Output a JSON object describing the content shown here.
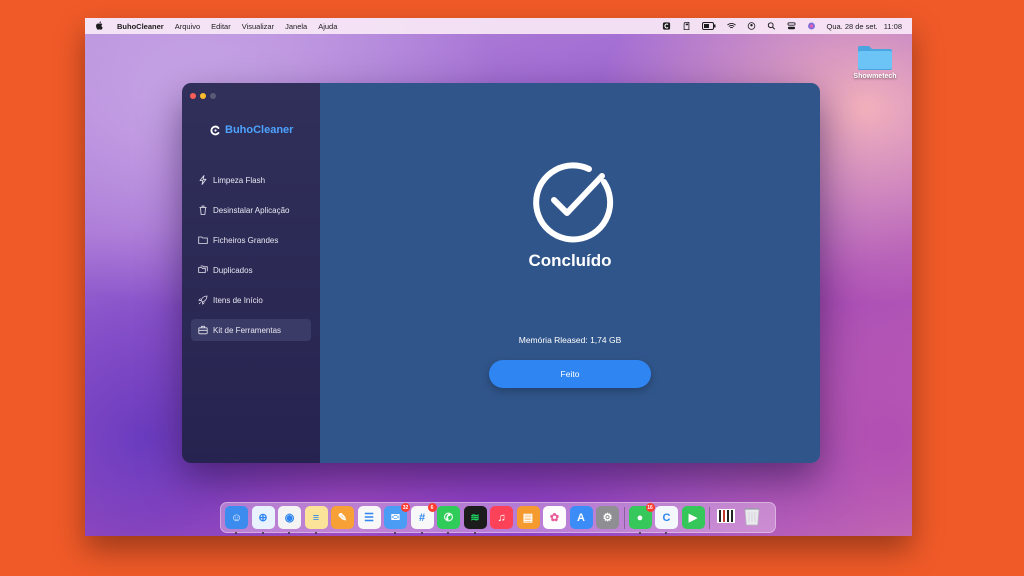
{
  "menubar": {
    "app_name": "BuhoCleaner",
    "menus": [
      "Arquivo",
      "Editar",
      "Visualizar",
      "Janela",
      "Ajuda"
    ],
    "date": "Qua. 28 de set.",
    "time": "11:08",
    "status_icons": [
      "buhocleaner-icon",
      "sd-card-icon",
      "battery-icon",
      "wifi-icon",
      "user-icon",
      "search-icon",
      "control-center-icon",
      "siri-icon"
    ]
  },
  "desktop": {
    "folder_label": "Showmetech",
    "folder_color": "#5bb6ec"
  },
  "window": {
    "traffic_colors": [
      "#ff5f57",
      "#febc2e",
      "#5a5a78"
    ],
    "brand": "BuhoCleaner",
    "brand_color": "#4da3ff",
    "nav": [
      {
        "label": "Limpeza Flash",
        "icon": "bolt-icon",
        "active": false
      },
      {
        "label": "Desinstalar Aplicação",
        "icon": "trash-icon",
        "active": false
      },
      {
        "label": "Ficheiros Grandes",
        "icon": "folder-icon",
        "active": false
      },
      {
        "label": "Duplicados",
        "icon": "duplicate-folder-icon",
        "active": false
      },
      {
        "label": "Itens de Início",
        "icon": "rocket-icon",
        "active": false
      },
      {
        "label": "Kit de Ferramentas",
        "icon": "toolbox-icon",
        "active": true
      }
    ],
    "main": {
      "status_title": "Concluído",
      "memory_text": "Memória Rleased: 1,74 GB",
      "done_button": "Feito",
      "accent": "#2f86f2",
      "background": "#30558a"
    }
  },
  "dock": {
    "apps": [
      {
        "name": "Finder",
        "icon": "finder-icon",
        "color": "#3c8cf0",
        "badge": null,
        "running": true
      },
      {
        "name": "Safari",
        "icon": "safari-icon",
        "color": "#e9f2ff",
        "badge": null,
        "running": true
      },
      {
        "name": "Chrome",
        "icon": "chrome-icon",
        "color": "#f4f4f4",
        "badge": null,
        "running": true
      },
      {
        "name": "Notes",
        "icon": "notes-icon",
        "color": "#fbe49a",
        "badge": null,
        "running": true
      },
      {
        "name": "Pages",
        "icon": "pages-icon",
        "color": "#f6a035",
        "badge": null,
        "running": false
      },
      {
        "name": "Reminders",
        "icon": "reminders-icon",
        "color": "#f8f8f8",
        "badge": null,
        "running": false
      },
      {
        "name": "Mail",
        "icon": "mail-icon",
        "color": "#4a9cf5",
        "badge": "32",
        "running": true
      },
      {
        "name": "Slack",
        "icon": "slack-icon",
        "color": "#f8f8f8",
        "badge": "6",
        "running": true
      },
      {
        "name": "WhatsApp",
        "icon": "whatsapp-icon",
        "color": "#2fcc5a",
        "badge": null,
        "running": true
      },
      {
        "name": "Spotify",
        "icon": "spotify-icon",
        "color": "#1c1c1c",
        "badge": null,
        "running": true
      },
      {
        "name": "Music",
        "icon": "music-icon",
        "color": "#fb4258",
        "badge": null,
        "running": false
      },
      {
        "name": "Books",
        "icon": "books-icon",
        "color": "#f59a2e",
        "badge": null,
        "running": false
      },
      {
        "name": "Photos",
        "icon": "photos-icon",
        "color": "#fdfdfd",
        "badge": null,
        "running": false
      },
      {
        "name": "App Store",
        "icon": "app-store-icon",
        "color": "#3b8cf6",
        "badge": null,
        "running": false
      },
      {
        "name": "System Preferences",
        "icon": "system-preferences-icon",
        "color": "#8e8e93",
        "badge": null,
        "running": false
      },
      {
        "name": "Messages",
        "icon": "messages-icon",
        "color": "#36c85a",
        "badge": "16",
        "running": true
      },
      {
        "name": "BuhoCleaner",
        "icon": "buhocleaner-dock-icon",
        "color": "#f4f7fb",
        "badge": null,
        "running": true
      },
      {
        "name": "FaceTime",
        "icon": "facetime-icon",
        "color": "#35c759",
        "badge": null,
        "running": false
      }
    ],
    "extras": [
      {
        "name": "Downloads stack",
        "icon": "stack-icon"
      },
      {
        "name": "Trash",
        "icon": "trash-can-icon"
      }
    ]
  }
}
